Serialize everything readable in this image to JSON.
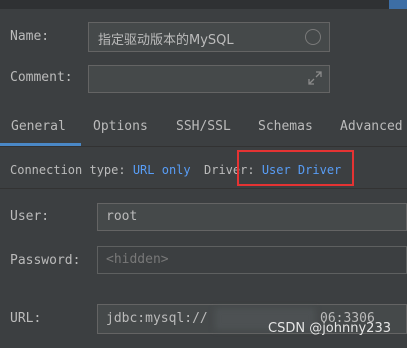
{
  "form": {
    "name_label": "Name:",
    "name_value": "指定驱动版本的MySQL",
    "comment_label": "Comment:",
    "comment_value": ""
  },
  "tabs": [
    {
      "label": "General",
      "selected": true
    },
    {
      "label": "Options",
      "selected": false
    },
    {
      "label": "SSH/SSL",
      "selected": false
    },
    {
      "label": "Schemas",
      "selected": false
    },
    {
      "label": "Advanced",
      "selected": false
    }
  ],
  "connection": {
    "type_label": "Connection type:",
    "type_value": "URL only",
    "driver_label": "Driver:",
    "driver_value": "User Driver",
    "highlight_color": "#e53333"
  },
  "fields": {
    "user_label": "User:",
    "user_value": "root",
    "password_label": "Password:",
    "password_placeholder": "<hidden>",
    "url_label": "URL:",
    "url_prefix": "jdbc:mysql://",
    "url_suffix": "06:3306"
  },
  "watermark": "CSDN @johnny233",
  "colors": {
    "background": "#3c3f41",
    "link": "#589df6",
    "tab_underline": "#4a88c7"
  },
  "icons": {
    "name_field_action": "circle-icon",
    "comment_expand": "expand-icon"
  }
}
